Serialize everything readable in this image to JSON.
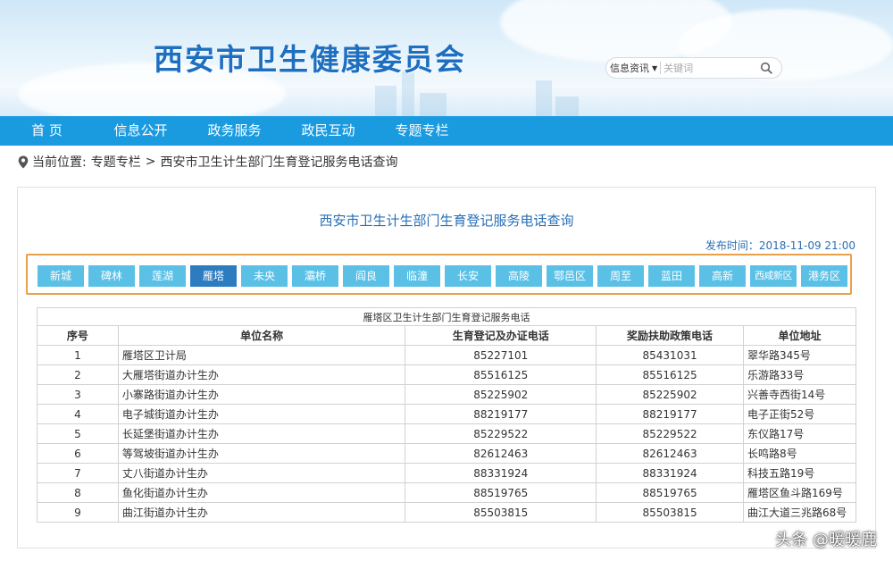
{
  "header": {
    "site_title": "西安市卫生健康委员会",
    "search": {
      "category": "信息资讯",
      "placeholder": "关键词"
    }
  },
  "nav": {
    "items": [
      "首 页",
      "信息公开",
      "政务服务",
      "政民互动",
      "专题专栏"
    ]
  },
  "breadcrumb": {
    "prefix": "当前位置:",
    "level1": "专题专栏",
    "separator": ">",
    "level2": "西安市卫生计生部门生育登记服务电话查询"
  },
  "page": {
    "title": "西安市卫生计生部门生育登记服务电话查询",
    "publish_time": "发布时间：2018-11-09 21:00"
  },
  "districts": {
    "items": [
      "新城",
      "碑林",
      "莲湖",
      "雁塔",
      "未央",
      "灞桥",
      "阎良",
      "临潼",
      "长安",
      "高陵",
      "鄠邑区",
      "周至",
      "蓝田",
      "高新",
      "西咸新区",
      "港务区"
    ],
    "active": "雁塔"
  },
  "table": {
    "caption": "雁塔区卫生计生部门生育登记服务电话",
    "headers": [
      "序号",
      "单位名称",
      "生育登记及办证电话",
      "奖励扶助政策电话",
      "单位地址"
    ],
    "rows": [
      [
        "1",
        "雁塔区卫计局",
        "85227101",
        "85431031",
        "翠华路345号"
      ],
      [
        "2",
        "大雁塔街道办计生办",
        "85516125",
        "85516125",
        "乐游路33号"
      ],
      [
        "3",
        "小寨路街道办计生办",
        "85225902",
        "85225902",
        "兴善寺西街14号"
      ],
      [
        "4",
        "电子城街道办计生办",
        "88219177",
        "88219177",
        "电子正街52号"
      ],
      [
        "5",
        "长延堡街道办计生办",
        "85229522",
        "85229522",
        "东仪路17号"
      ],
      [
        "6",
        "等驾坡街道办计生办",
        "82612463",
        "82612463",
        "长鸣路8号"
      ],
      [
        "7",
        "丈八街道办计生办",
        "88331924",
        "88331924",
        "科技五路19号"
      ],
      [
        "8",
        "鱼化街道办计生办",
        "88519765",
        "88519765",
        "雁塔区鱼斗路169号"
      ],
      [
        "9",
        "曲江街道办计生办",
        "85503815",
        "85503815",
        "曲江大道三兆路68号"
      ]
    ]
  },
  "watermark": "头条 @暖暖鹿",
  "colors": {
    "nav_bg": "#1a9be0",
    "title_blue": "#1e6fc0",
    "district_btn": "#5bc0e6",
    "district_active": "#2e7cc0",
    "district_border": "#e8a04a"
  }
}
